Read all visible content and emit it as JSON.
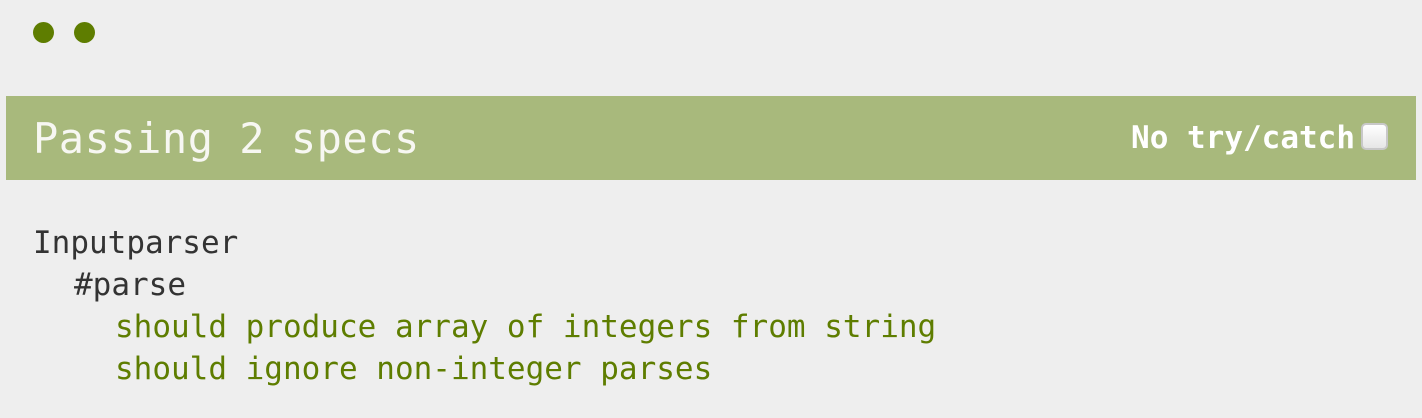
{
  "status_dots": [
    {
      "status": "passed",
      "color": "#5e7d00"
    },
    {
      "status": "passed",
      "color": "#5e7d00"
    }
  ],
  "alert_bar": {
    "text": "Passing 2 specs",
    "background_color": "#a8b97c",
    "option_label": "No try/catch",
    "option_checked": false
  },
  "results": {
    "suite": "Inputparser",
    "subsuite": "#parse",
    "specs": [
      "should produce array of integers from string",
      "should ignore non-integer parses"
    ],
    "spec_color": "#5e7d00"
  }
}
